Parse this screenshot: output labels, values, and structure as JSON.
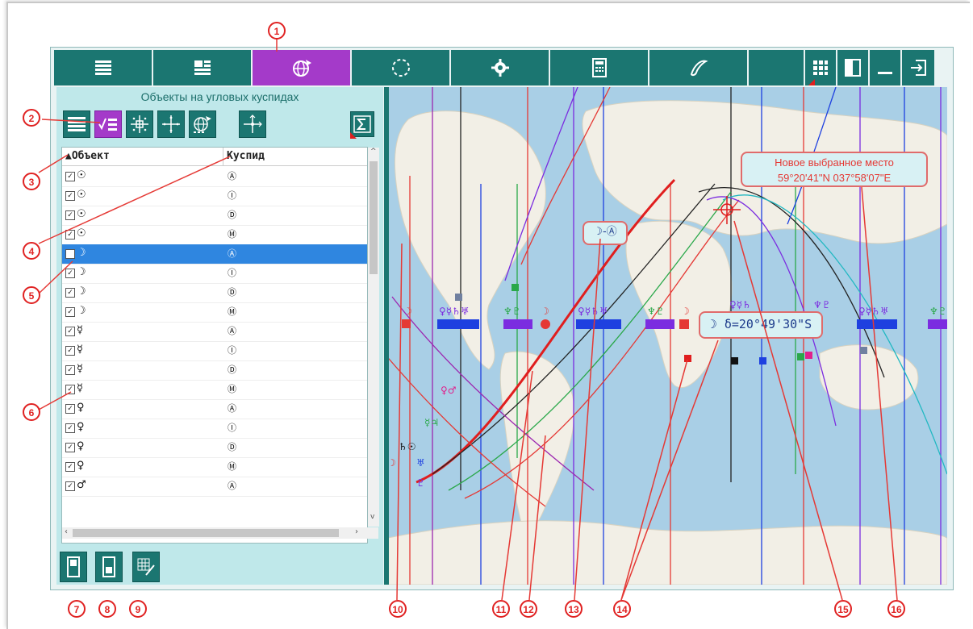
{
  "panel": {
    "title": "Объекты на угловых куспидах",
    "columns": {
      "object": "▲Объект",
      "cusp": "Куспид"
    },
    "rows": [
      {
        "checked": true,
        "object": "☉",
        "cusp": "Ⓐ"
      },
      {
        "checked": true,
        "object": "☉",
        "cusp": "Ⓘ"
      },
      {
        "checked": true,
        "object": "☉",
        "cusp": "Ⓓ"
      },
      {
        "checked": true,
        "object": "☉",
        "cusp": "Ⓜ"
      },
      {
        "checked": false,
        "object": "☽",
        "cusp": "Ⓐ",
        "selected": true
      },
      {
        "checked": true,
        "object": "☽",
        "cusp": "Ⓘ"
      },
      {
        "checked": true,
        "object": "☽",
        "cusp": "Ⓓ"
      },
      {
        "checked": true,
        "object": "☽",
        "cusp": "Ⓜ"
      },
      {
        "checked": true,
        "object": "☿",
        "cusp": "Ⓐ"
      },
      {
        "checked": true,
        "object": "☿",
        "cusp": "Ⓘ"
      },
      {
        "checked": true,
        "object": "☿",
        "cusp": "Ⓓ"
      },
      {
        "checked": true,
        "object": "☿",
        "cusp": "Ⓜ"
      },
      {
        "checked": true,
        "object": "♀",
        "cusp": "Ⓐ"
      },
      {
        "checked": true,
        "object": "♀",
        "cusp": "Ⓘ"
      },
      {
        "checked": true,
        "object": "♀",
        "cusp": "Ⓓ"
      },
      {
        "checked": true,
        "object": "♀",
        "cusp": "Ⓜ"
      },
      {
        "checked": true,
        "object": "♂",
        "cusp": "Ⓐ"
      }
    ]
  },
  "map": {
    "callout_place_line1": "Новое выбранное место",
    "callout_place_line2": "59°20'41\"N 037°58'07\"E",
    "callout_moon_line": "☽-Ⓐ",
    "callout_declination": "☽ δ=20°49'30\"S"
  },
  "markers": [
    "1",
    "2",
    "3",
    "4",
    "5",
    "6",
    "7",
    "8",
    "9",
    "10",
    "11",
    "12",
    "13",
    "14",
    "15",
    "16"
  ],
  "icons": {
    "toolbar": [
      "list-icon",
      "layout-icon",
      "world-map-icon",
      "circle-chart-icon",
      "gear-icon",
      "calculator-icon",
      "script-icon",
      "grid-icon",
      "panel-icon",
      "minimize-icon",
      "exit-icon"
    ],
    "panel_tools": [
      "list-view-icon",
      "checklist-icon",
      "cross-grid-icon",
      "cross-icon",
      "world-pen-icon",
      "cross-arrows-icon",
      "sum-icon"
    ],
    "bottom": [
      "split-left-icon",
      "split-right-icon",
      "chart-pen-icon"
    ]
  },
  "colors": {
    "accent": "#1b7671",
    "active": "#a43ac9",
    "selection": "#2f86e0",
    "callout_border": "#e06b6b"
  }
}
